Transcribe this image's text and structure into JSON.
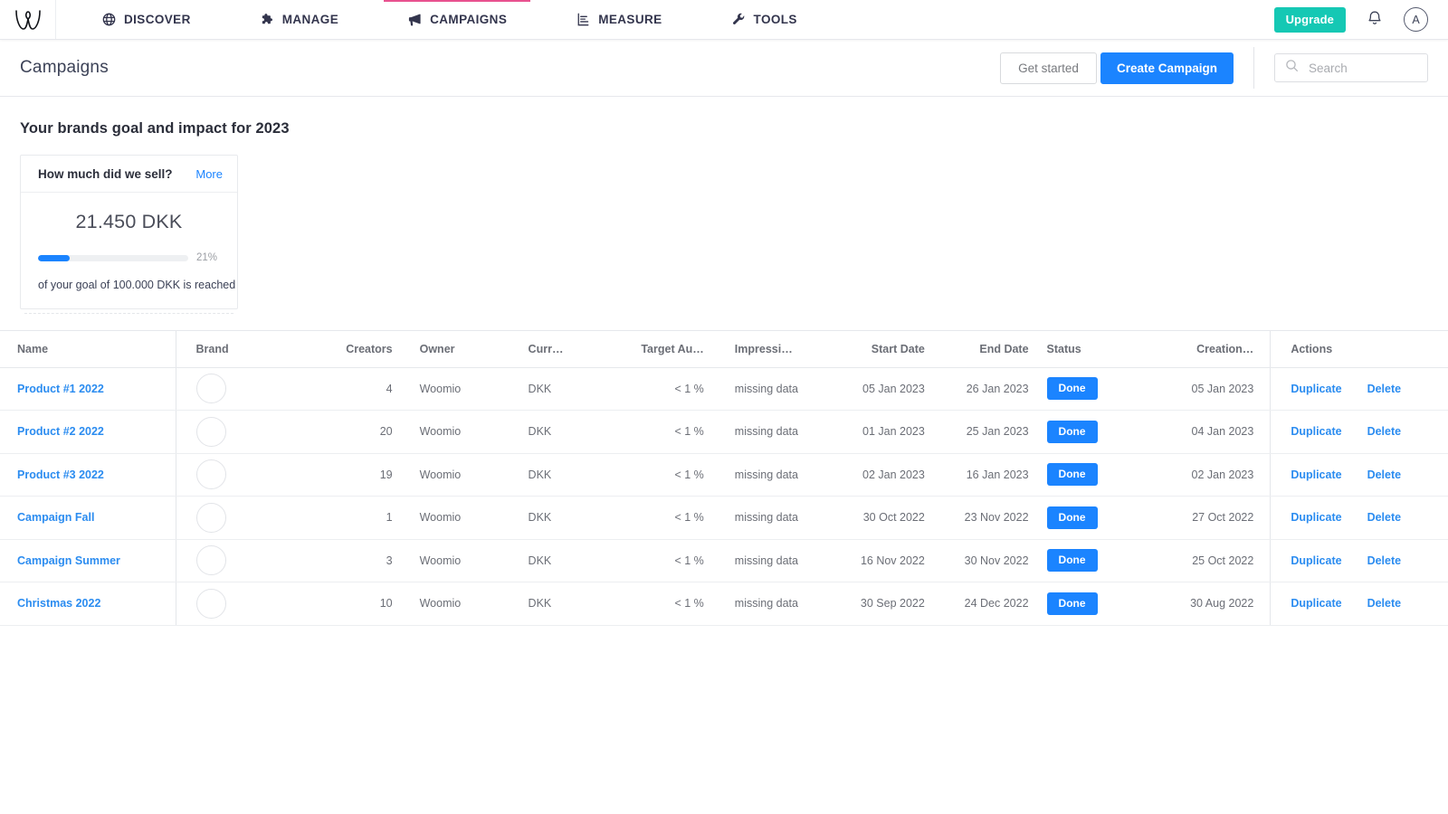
{
  "topnav": {
    "logo": "woomio-w-logo",
    "items": [
      {
        "label": "DISCOVER",
        "icon": "globe-icon",
        "active": false
      },
      {
        "label": "MANAGE",
        "icon": "puzzle-icon",
        "active": false
      },
      {
        "label": "CAMPAIGNS",
        "icon": "megaphone-icon",
        "active": true
      },
      {
        "label": "MEASURE",
        "icon": "chart-icon",
        "active": false
      },
      {
        "label": "TOOLS",
        "icon": "wrench-icon",
        "active": false
      }
    ],
    "upgrade_label": "Upgrade",
    "notifications_icon": "bell-icon",
    "avatar_letter": "A",
    "active_underline_color": "#e8518f",
    "upgrade_color": "#15c8b4"
  },
  "page_header": {
    "title": "Campaigns",
    "get_started_label": "Get started",
    "create_campaign_label": "Create Campaign",
    "search": {
      "value": "",
      "placeholder": "Search",
      "icon": "search-icon"
    },
    "primary_color": "#1b84ff"
  },
  "goal": {
    "heading": "Your brands goal and impact for 2023",
    "card_title": "How much did we sell?",
    "more_label": "More",
    "amount": "21.450 DKK",
    "progress_percent": "21%",
    "progress_value": 21,
    "subtext": "of your goal of 100.000 DKK is reached",
    "bar_color": "#1b84ff"
  },
  "table": {
    "columns": [
      "Name",
      "Brand",
      "Creators",
      "Owner",
      "Curr…",
      "Target Au…",
      "Impressi…",
      "Start Date",
      "End Date",
      "Status",
      "Creation…",
      "Actions"
    ],
    "rows": [
      {
        "name": "Product #1 2022",
        "brand": "",
        "creators": "4",
        "owner": "Woomio",
        "currency": "DKK",
        "target_audience": "< 1 %",
        "impressions": "missing data",
        "start_date": "05 Jan 2023",
        "end_date": "26 Jan 2023",
        "status": "Done",
        "creation_date": "05 Jan 2023",
        "duplicate": "Duplicate",
        "delete": "Delete"
      },
      {
        "name": "Product #2 2022",
        "brand": "",
        "creators": "20",
        "owner": "Woomio",
        "currency": "DKK",
        "target_audience": "< 1 %",
        "impressions": "missing data",
        "start_date": "01 Jan 2023",
        "end_date": "25 Jan 2023",
        "status": "Done",
        "creation_date": "04 Jan 2023",
        "duplicate": "Duplicate",
        "delete": "Delete"
      },
      {
        "name": "Product #3 2022",
        "brand": "",
        "creators": "19",
        "owner": "Woomio",
        "currency": "DKK",
        "target_audience": "< 1 %",
        "impressions": "missing data",
        "start_date": "02 Jan 2023",
        "end_date": "16 Jan 2023",
        "status": "Done",
        "creation_date": "02 Jan 2023",
        "duplicate": "Duplicate",
        "delete": "Delete"
      },
      {
        "name": "Campaign Fall",
        "brand": "",
        "creators": "1",
        "owner": "Woomio",
        "currency": "DKK",
        "target_audience": "< 1 %",
        "impressions": "missing data",
        "start_date": "30 Oct 2022",
        "end_date": "23 Nov 2022",
        "status": "Done",
        "creation_date": "27 Oct 2022",
        "duplicate": "Duplicate",
        "delete": "Delete"
      },
      {
        "name": "Campaign Summer",
        "brand": "",
        "creators": "3",
        "owner": "Woomio",
        "currency": "DKK",
        "target_audience": "< 1 %",
        "impressions": "missing data",
        "start_date": "16 Nov 2022",
        "end_date": "30 Nov 2022",
        "status": "Done",
        "creation_date": "25 Oct 2022",
        "duplicate": "Duplicate",
        "delete": "Delete"
      },
      {
        "name": "Christmas 2022",
        "brand": "",
        "creators": "10",
        "owner": "Woomio",
        "currency": "DKK",
        "target_audience": "< 1 %",
        "impressions": "missing data",
        "start_date": "30 Sep 2022",
        "end_date": "24 Dec 2022",
        "status": "Done",
        "creation_date": "30 Aug 2022",
        "duplicate": "Duplicate",
        "delete": "Delete"
      }
    ],
    "status_color": "#1b84ff",
    "link_color": "#2b8cf0"
  }
}
